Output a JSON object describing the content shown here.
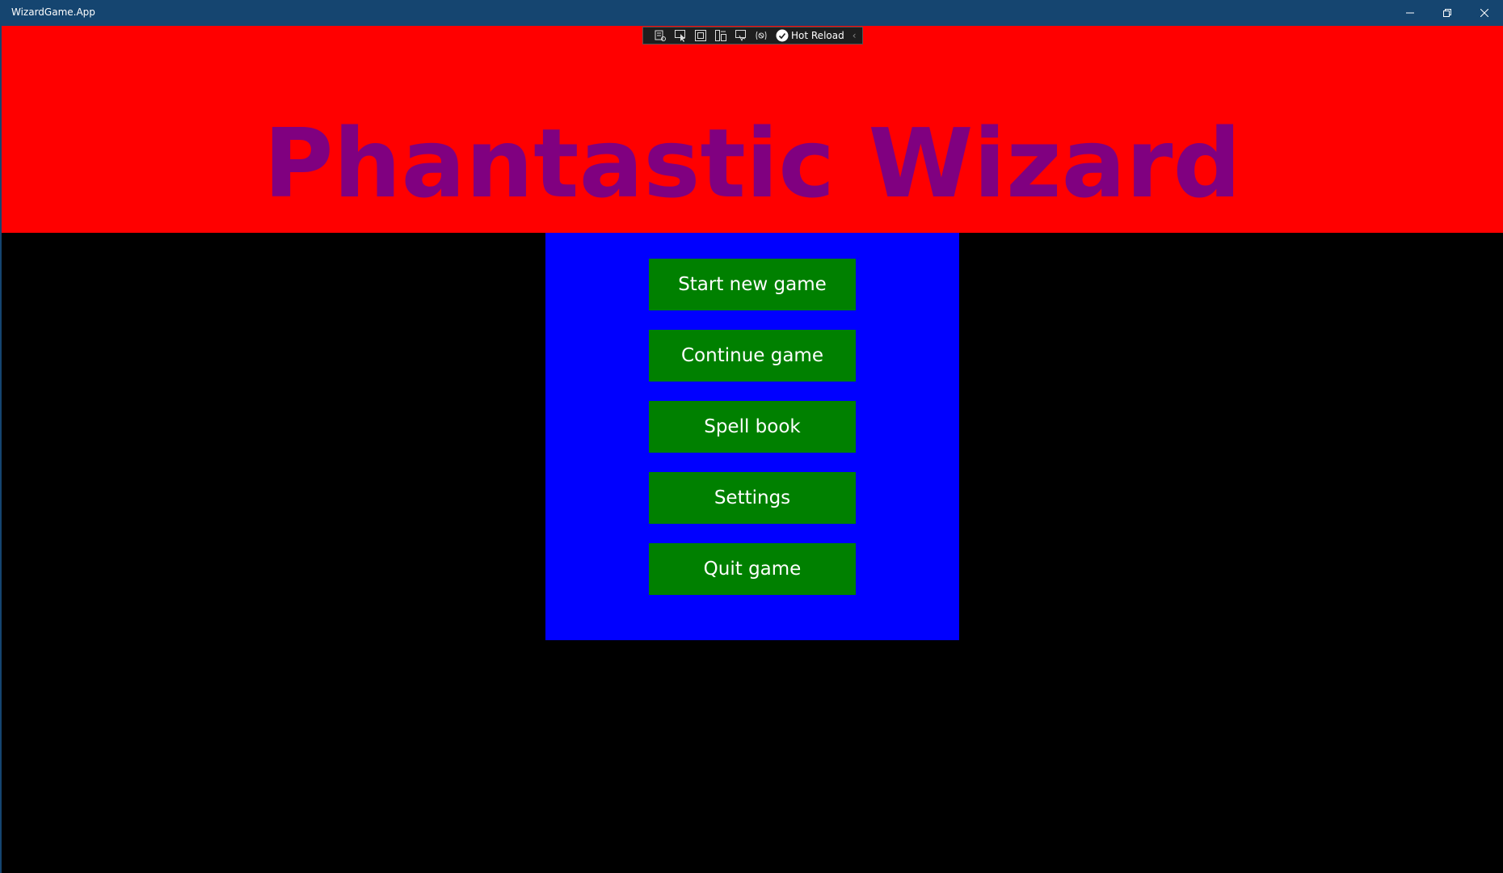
{
  "window": {
    "title": "WizardGame.App",
    "titlebar_color": "#154570",
    "buttons": [
      {
        "name": "minimize",
        "icon": "minimize-icon"
      },
      {
        "name": "restore",
        "icon": "restore-icon"
      },
      {
        "name": "close",
        "icon": "close-icon"
      }
    ]
  },
  "debug_toolbar": {
    "icons": [
      "live-visual-tree-icon",
      "select-element-icon",
      "display-layout-adorners-icon",
      "track-focus-icon",
      "display-accessibility-icon",
      "binding-failures-icon"
    ],
    "hot_reload_label": "Hot Reload",
    "status_icon": "check-circle-icon",
    "collapse_icon": "chevron-left-icon",
    "collapse_glyph": "‹"
  },
  "header": {
    "title": "Phantastic Wizard",
    "background": "#ff0000",
    "title_color": "#800080"
  },
  "menu": {
    "panel_color": "#0000ff",
    "button_color": "#008000",
    "buttons": [
      {
        "label": "Start new game"
      },
      {
        "label": "Continue game"
      },
      {
        "label": "Spell book"
      },
      {
        "label": "Settings"
      },
      {
        "label": "Quit game"
      }
    ]
  },
  "background": "#000000"
}
